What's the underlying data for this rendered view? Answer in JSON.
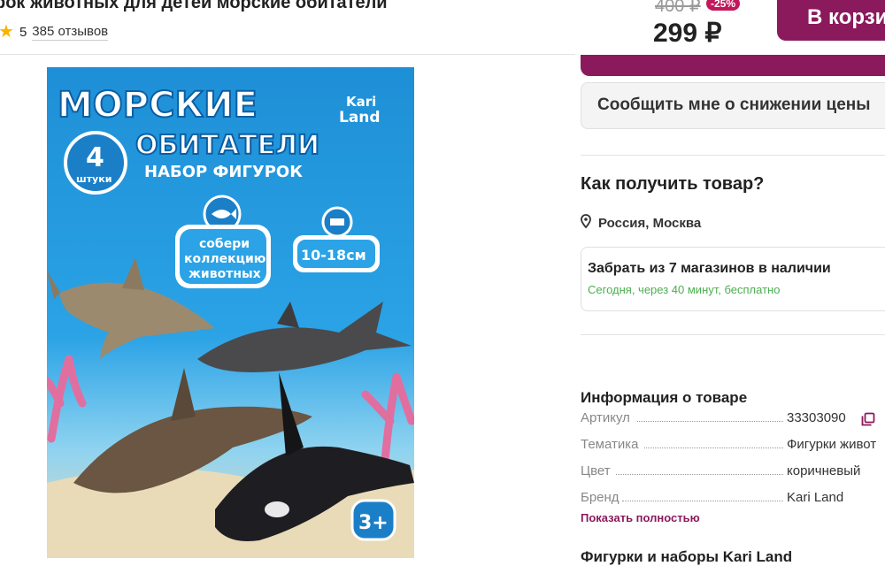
{
  "product": {
    "title": "рок животных для детей морские обитатели",
    "rating_value": "5",
    "reviews": "385 отзывов"
  },
  "pricing": {
    "old_price": "400 ₽",
    "discount": "-25%",
    "price": "299 ₽",
    "cart_label": "В корзи"
  },
  "notify_label": "Сообщить мне о снижении цены",
  "delivery": {
    "heading": "Как получить товар?",
    "location": "Россия, Москва",
    "pickup_title": "Забрать из 7 магазинов в наличии",
    "pickup_subtitle": "Сегодня, через 40 минут, бесплатно"
  },
  "info": {
    "heading": "Информация о товаре",
    "specs": [
      {
        "label": "Артикул",
        "value": "33303090"
      },
      {
        "label": "Тематика",
        "value": "Фигурки живот"
      },
      {
        "label": "Цвет",
        "value": "коричневый"
      },
      {
        "label": "Бренд",
        "value": "Kari Land"
      }
    ],
    "show_more": "Показать полностью"
  },
  "bottom_heading": "Фигурки и наборы Kari Land",
  "image": {
    "title_line1": "МОРСКИЕ",
    "title_line2": "ОБИТАТЕЛИ",
    "subtitle": "НАБОР ФИГУРОК",
    "count_number": "4",
    "count_label": "штуки",
    "brand_line1": "Kari",
    "brand_line2": "Land",
    "badge_line1": "собери",
    "badge_line2": "коллекцию",
    "badge_line3": "животных",
    "size_badge": "10-18см",
    "age_badge": "3+"
  },
  "colors": {
    "brand": "#8b1a5c",
    "discount": "#c2185b",
    "success": "#4caf50",
    "star": "#f7b500",
    "image_sky": "#1e8fd6"
  },
  "icons": [
    "star-icon",
    "location-pin-icon",
    "copy-icon",
    "fish-icon",
    "ruler-icon"
  ]
}
